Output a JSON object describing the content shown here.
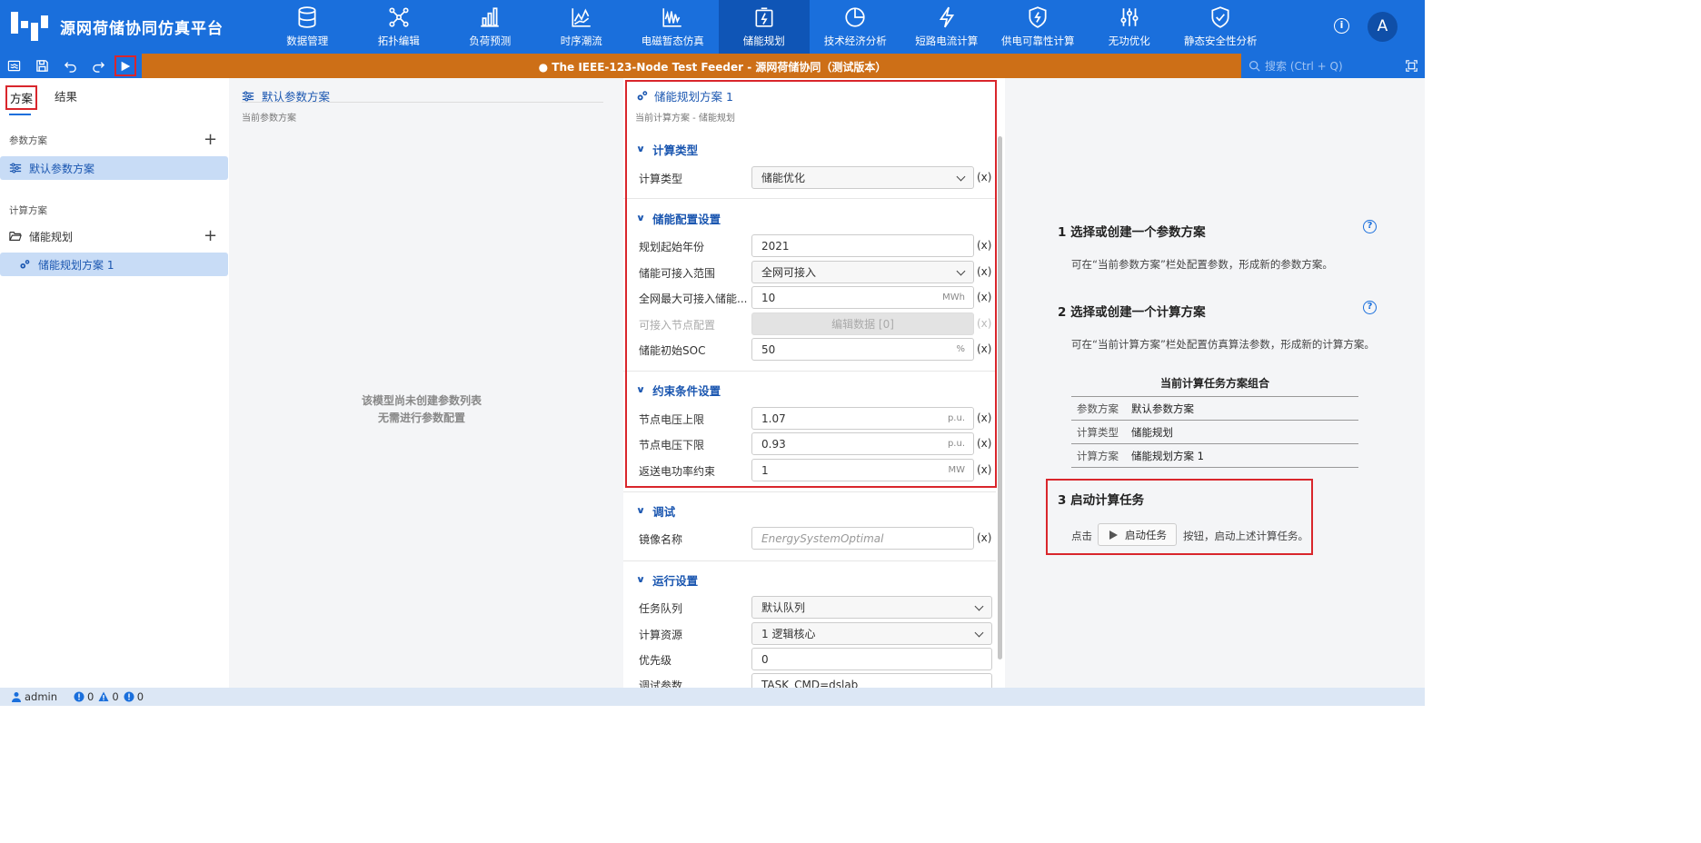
{
  "app": {
    "title": "源网荷储协同仿真平台",
    "doc_title": "● The IEEE-123-Node Test Feeder - 源网荷储协同（测试版本）",
    "avatar_initial": "A",
    "help_glyph": "i"
  },
  "nav": {
    "items": [
      {
        "label": "数据管理",
        "icon": "database-icon"
      },
      {
        "label": "拓扑编辑",
        "icon": "topology-icon"
      },
      {
        "label": "负荷预测",
        "icon": "bar-chart-icon"
      },
      {
        "label": "时序潮流",
        "icon": "line-chart-icon"
      },
      {
        "label": "电磁暂态仿真",
        "icon": "waveform-icon"
      },
      {
        "label": "储能规划",
        "icon": "battery-icon"
      },
      {
        "label": "技术经济分析",
        "icon": "pie-chart-icon"
      },
      {
        "label": "短路电流计算",
        "icon": "lightning-icon"
      },
      {
        "label": "供电可靠性计算",
        "icon": "shield-bolt-icon"
      },
      {
        "label": "无功优化",
        "icon": "sliders-icon"
      },
      {
        "label": "静态安全性分析",
        "icon": "shield-check-icon"
      }
    ],
    "active": "储能规划"
  },
  "toolbar": {
    "search_placeholder": "搜索 (Ctrl + Q)"
  },
  "left": {
    "tabs": [
      "方案",
      "结果"
    ],
    "param_section": "参数方案",
    "param_item": "默认参数方案",
    "calc_section": "计算方案",
    "calc_folder": "储能规划",
    "calc_item": "储能规划方案 1"
  },
  "middle": {
    "title": "默认参数方案",
    "subtitle": "当前参数方案",
    "empty_line1": "该模型尚未创建参数列表",
    "empty_line2": "无需进行参数配置"
  },
  "form": {
    "title": "储能规划方案 1",
    "subtitle": "当前计算方案 - 储能规划",
    "x": "(x)",
    "groups": {
      "calc_type": "计算类型",
      "storage": "储能配置设置",
      "constraint": "约束条件设置",
      "debug": "调试",
      "run": "运行设置"
    },
    "fields": {
      "calc_type": {
        "label": "计算类型",
        "value": "储能优化"
      },
      "start_year": {
        "label": "规划起始年份",
        "value": "2021"
      },
      "access_range": {
        "label": "储能可接入范围",
        "value": "全网可接入"
      },
      "max_capacity": {
        "label": "全网最大可接入储能...",
        "value": "10",
        "unit": "MWh"
      },
      "node_config": {
        "label": "可接入节点配置",
        "value": "编辑数据 [0]"
      },
      "init_soc": {
        "label": "储能初始SOC",
        "value": "50",
        "unit": "%"
      },
      "v_upper": {
        "label": "节点电压上限",
        "value": "1.07",
        "unit": "p.u."
      },
      "v_lower": {
        "label": "节点电压下限",
        "value": "0.93",
        "unit": "p.u."
      },
      "reverse_power": {
        "label": "返送电功率约束",
        "value": "1",
        "unit": "MW"
      },
      "image_name": {
        "label": "镜像名称",
        "placeholder": "EnergySystemOptimal"
      },
      "task_queue": {
        "label": "任务队列",
        "value": "默认队列"
      },
      "compute_res": {
        "label": "计算资源",
        "value": "1 逻辑核心"
      },
      "priority": {
        "label": "优先级",
        "value": "0"
      },
      "debug_params": {
        "label": "调试参数",
        "value": "TASK_CMD=dslab"
      }
    }
  },
  "guide": {
    "step1_title": "1  选择或创建一个参数方案",
    "step1_desc": "可在“当前参数方案”栏处配置参数，形成新的参数方案。",
    "step2_title": "2  选择或创建一个计算方案",
    "step2_desc": "可在“当前计算方案”栏处配置仿真算法参数，形成新的计算方案。",
    "combo_title": "当前计算任务方案组合",
    "combo_rows": [
      {
        "k": "参数方案",
        "v": "默认参数方案"
      },
      {
        "k": "计算类型",
        "v": "储能规划"
      },
      {
        "k": "计算方案",
        "v": "储能规划方案 1"
      }
    ],
    "step3_title": "3  启动计算任务",
    "step3_prefix": "点击",
    "start_button": "启动任务",
    "step3_suffix": "按钮，启动上述计算任务。",
    "help_glyph": "?"
  },
  "status": {
    "user": "admin",
    "errors": "0",
    "warnings": "0",
    "infos": "0"
  },
  "colors": {
    "primary": "#1a6fdc",
    "toolbar_orange": "#cd6f17",
    "highlight_red": "#d9262c"
  }
}
